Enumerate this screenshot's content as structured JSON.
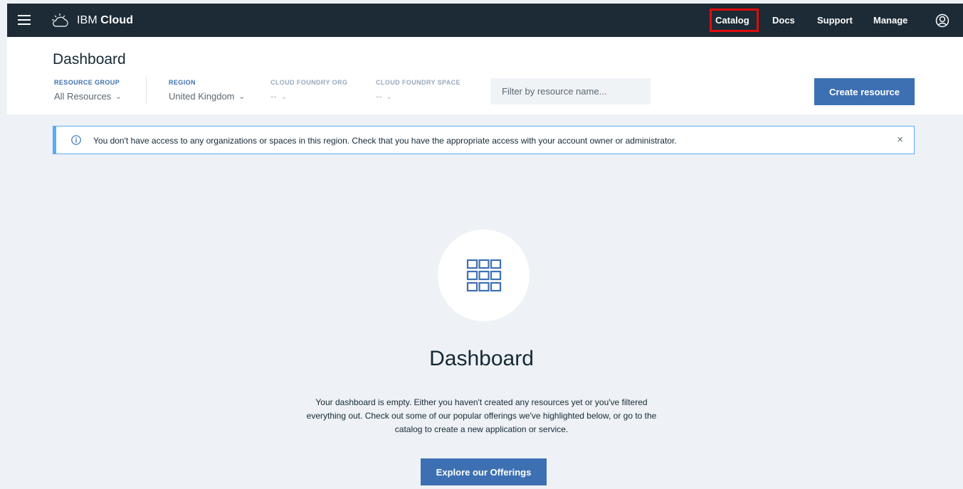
{
  "topbar": {
    "brand_light": "IBM",
    "brand_bold": "Cloud",
    "nav": [
      {
        "label": "Catalog"
      },
      {
        "label": "Docs"
      },
      {
        "label": "Support"
      },
      {
        "label": "Manage"
      }
    ],
    "highlight_color": "#e10b0b",
    "icons": [
      "hamburger-menu-icon",
      "cloud-logo-icon",
      "user-avatar-icon"
    ]
  },
  "header": {
    "title": "Dashboard",
    "filters": [
      {
        "label": "RESOURCE GROUP",
        "value": "All Resources"
      },
      {
        "label": "REGION",
        "value": "United Kingdom"
      },
      {
        "label": "CLOUD FOUNDRY ORG",
        "value": "--"
      },
      {
        "label": "CLOUD FOUNDRY SPACE",
        "value": "--"
      }
    ],
    "search_placeholder": "Filter by resource name...",
    "create_button": "Create resource"
  },
  "banner": {
    "message": "You don't have access to any organizations or spaces in this region. Check that you have the appropriate access with your account owner or administrator.",
    "close_glyph": "×"
  },
  "empty_state": {
    "title": "Dashboard",
    "description": "Your dashboard is empty. Either you haven't created any resources yet or you've filtered everything out. Check out some of our popular offerings we've highlighted below, or go to the catalog to create a new application or service.",
    "button": "Explore our Offerings"
  },
  "colors": {
    "nav_bg": "#1c2b36",
    "accent": "#3d70b2",
    "info": "#5aaafa",
    "page_bg": "#eef1f5"
  }
}
